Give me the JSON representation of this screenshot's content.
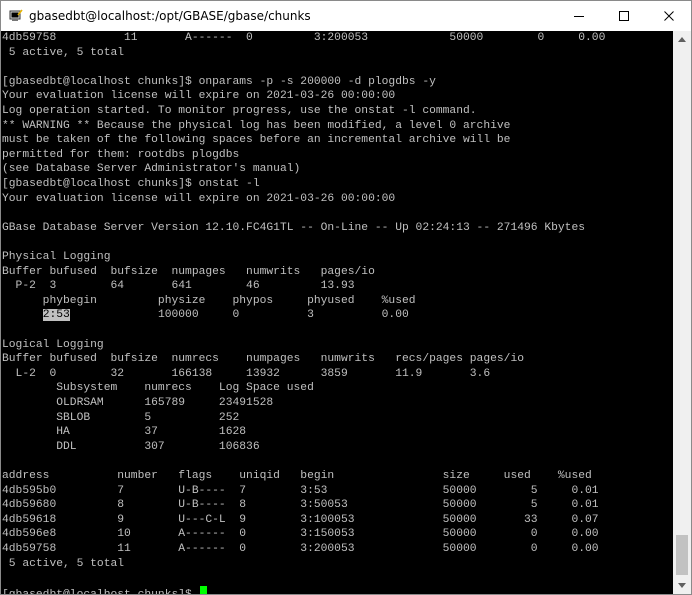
{
  "window": {
    "title": "gbasedbt@localhost:/opt/GBASE/gbase/chunks",
    "icon": "putty-terminal-icon",
    "buttons": [
      "minimize",
      "maximize",
      "close"
    ]
  },
  "colors": {
    "terminal_background": "#000000",
    "terminal_text": "#c0c0c0",
    "cursor": "#00ff00",
    "selection_background": "#c0c0c0"
  },
  "terminal": {
    "lines": [
      "4db59758          11       A------  0         3:200053            50000        0     0.00",
      " 5 active, 5 total",
      "",
      "[gbasedbt@localhost chunks]$ onparams -p -s 200000 -d plogdbs -y",
      "Your evaluation license will expire on 2021-03-26 00:00:00",
      "Log operation started. To monitor progress, use the onstat -l command.",
      "** WARNING ** Because the physical log has been modified, a level 0 archive",
      "must be taken of the following spaces before an incremental archive will be",
      "permitted for them: rootdbs plogdbs",
      "(see Database Server Administrator's manual)",
      "[gbasedbt@localhost chunks]$ onstat -l",
      "Your evaluation license will expire on 2021-03-26 00:00:00",
      "",
      "GBase Database Server Version 12.10.FC4G1TL -- On-Line -- Up 02:24:13 -- 271496 Kbytes",
      "",
      "Physical Logging",
      "Buffer bufused  bufsize  numpages   numwrits   pages/io",
      "  P-2  3        64       641        46         13.93",
      "      phybegin         physize    phypos     phyused    %used",
      "      2:53             100000     0          3          0.00",
      "",
      "Logical Logging",
      "Buffer bufused  bufsize  numrecs    numpages   numwrits   recs/pages pages/io",
      "  L-2  0        32       166138     13932      3859       11.9       3.6",
      "        Subsystem    numrecs    Log Space used",
      "        OLDRSAM      165789     23491528",
      "        SBLOB        5          252",
      "        HA           37         1628",
      "        DDL          307        106836",
      "",
      "address          number   flags    uniqid   begin                size     used    %used",
      "4db595b0         7        U-B----  7        3:53                 50000        5     0.01",
      "4db59680         8        U-B----  8        3:50053              50000        5     0.01",
      "4db59618         9        U---C-L  9        3:100053             50000       33     0.07",
      "4db596e8         10       A------  0        3:150053             50000        0     0.00",
      "4db59758         11       A------  0        3:200053             50000        0     0.00",
      " 5 active, 5 total",
      "",
      "[gbasedbt@localhost chunks]$ "
    ],
    "selection": {
      "line_index": 19,
      "text": "2:53"
    }
  }
}
